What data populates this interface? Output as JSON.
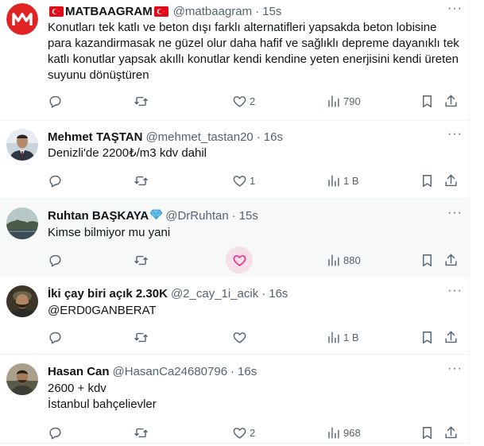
{
  "colors": {
    "accent": "#1d9bf0",
    "muted": "#536471",
    "like": "#f91880",
    "border": "#eff3f4",
    "hover_bg": "#f7f9f9"
  },
  "tweets": [
    {
      "name": "MATBAAGRAM",
      "name_flags": "🇹🇷",
      "handle": "@matbaagram",
      "time": "15s",
      "text": [
        "Konutları tek katlı ve beton dışı farklı alternatifleri yapsakda beton lobisine para kazandirmasak  ne güzel olur daha hafif ve sağlıklı depreme dayanıklı tek katlı konutlar yapsak akıllı konutlar kendi kendine yeten enerjisini kendi üreten suyunu dönüştüren"
      ],
      "likes": "2",
      "views": "790",
      "avatar": "matbaagram-logo"
    },
    {
      "name": "Mehmet TAŞTAN",
      "handle": "@mehmet_tastan20",
      "time": "16s",
      "text": [
        "Denizli'de 2200₺/m3 kdv dahil"
      ],
      "likes": "1",
      "views": "1 B",
      "avatar": "man-in-suit-photo"
    },
    {
      "name": "Ruhtan BAŞKAYA",
      "name_badge": "💎",
      "handle": "@DrRuhtan",
      "time": "15s",
      "text": [
        "Kimse bilmiyor mu yani"
      ],
      "likes": "",
      "views": "880",
      "avatar": "landscape-photo"
    },
    {
      "name": "İki çay biri açık 2.30K",
      "handle": "@2_cay_1i_acik",
      "time": "16s",
      "text": [
        "@ERD0GANBERAT"
      ],
      "likes": "",
      "views": "1 B",
      "avatar": "bearded-man-photo"
    },
    {
      "name": "Hasan Can",
      "handle": "@HasanCa24680796",
      "time": "16s",
      "text": [
        "2600 + kdv",
        "İstanbul bahçelievler"
      ],
      "likes": "2",
      "views": "968",
      "avatar": "man-photo"
    }
  ],
  "icons": {
    "reply": "reply-icon",
    "retweet": "retweet-icon",
    "like": "heart-icon",
    "views": "views-icon",
    "bookmark": "bookmark-icon",
    "share": "share-icon",
    "more": "more-icon"
  },
  "more_glyph": "···",
  "separator": "·"
}
